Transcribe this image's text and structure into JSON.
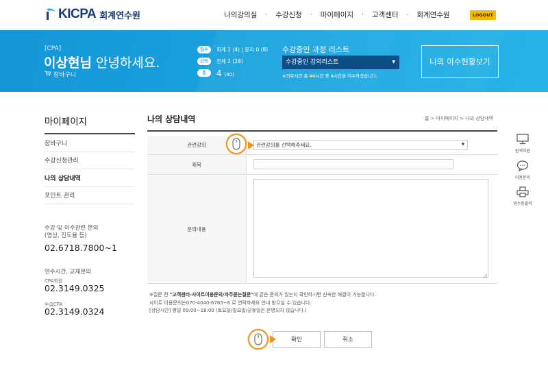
{
  "header": {
    "logo_text": "KICPA",
    "logo_sub": "회계연수원",
    "nav": [
      "나의강의실",
      "수강신청",
      "마이페이지",
      "고객센터",
      "회계연수원"
    ],
    "nav_sep": "·",
    "logout_label": "LOGOUT"
  },
  "banner": {
    "cpa_label": "[CPA]",
    "user_name": "이상현님",
    "greeting_suffix": " 안녕하세요.",
    "cart_label": "장바구니",
    "stats": [
      {
        "pill": "필수",
        "value": "회계 2 (4) | 윤리 0 (8)"
      },
      {
        "pill": "선택",
        "value": "전체 2 (28)"
      },
      {
        "pill": "총",
        "value": "4",
        "sub": "(40)"
      }
    ],
    "course_list_title": "수강중인 과정 리스트",
    "course_select_value": "수강중인 강의리스트",
    "course_note_prefix": "※의무시간 총 ",
    "course_note_total": "40",
    "course_note_mid": "시간 중 ",
    "course_note_done": "4",
    "course_note_suffix": "시간을 이수하셨습니다.",
    "status_button": "나의 이수현황보기"
  },
  "sidebar": {
    "title": "마이페이지",
    "items": [
      {
        "label": "장바구니",
        "active": false
      },
      {
        "label": "수강신청관리",
        "active": false
      },
      {
        "label": "나의 상담내역",
        "active": true
      },
      {
        "label": "포인트 관리",
        "active": false
      }
    ],
    "contact1_line1": "수강 및 이수관련 문의",
    "contact1_line2": "(영상, 진도율 등)",
    "contact1_phone": "02.6718.7800~1",
    "contact2_title": "연수시간, 교재문의",
    "contact2_sub1": "CPA회원",
    "contact2_phone1": "02.3149.0325",
    "contact2_sub2": "수습CPA",
    "contact2_phone2": "02.3149.0324"
  },
  "main": {
    "title": "나의 상담내역",
    "breadcrumb": "홈 > 마이페이지 > 나의 상담내역",
    "form": {
      "course_label": "관련강의",
      "course_placeholder": "관련강의를 선택해주세요.",
      "subject_label": "제목",
      "subject_value": "",
      "content_label": "문의내용",
      "content_value": ""
    },
    "notes": {
      "line1_prefix": "※질문 전 ",
      "line1_bold": "\"고객센터-사이트이용문의/자주묻는질문\"",
      "line1_suffix": "에 같은 문의가 있는지 확인하시면 신속한 해결이 가능합니다.",
      "line2": "사이트 이용문의는070-4040-6765~6 로 연락하세요 안내 받으실 수 있습니다.",
      "line3": "[상담시간] 평일 09:00~18:00 (토요일/일요일/공휴일은 운영되지 않습니다.)"
    },
    "confirm_label": "확인",
    "cancel_label": "취소"
  },
  "quick_links": [
    {
      "label": "원격지원",
      "icon": "monitor-icon"
    },
    {
      "label": "이용문의",
      "icon": "chat-icon"
    },
    {
      "label": "영수증출력",
      "icon": "printer-icon"
    }
  ],
  "colors": {
    "banner": "#1ba6e0",
    "logo": "#1a3b7a",
    "logout": "#f5b800",
    "highlight": "#f0921e"
  }
}
